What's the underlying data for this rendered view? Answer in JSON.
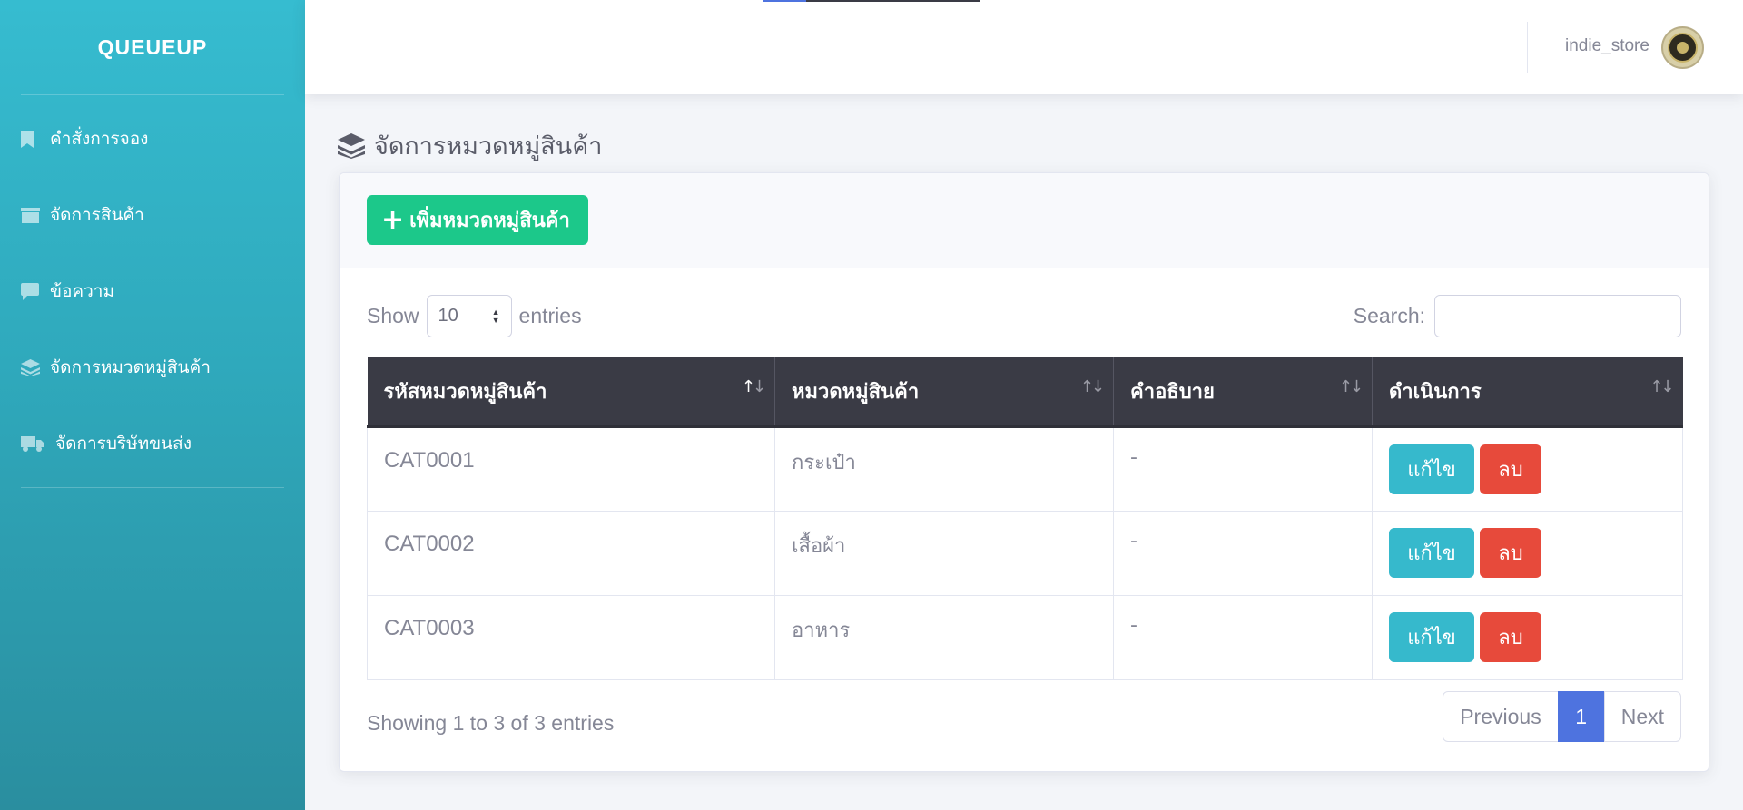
{
  "brand": "QUEUEUP",
  "sidebar": {
    "items": [
      {
        "label": "คำสั่งการจอง",
        "icon": "bookmark-icon"
      },
      {
        "label": "จัดการสินค้า",
        "icon": "box-icon"
      },
      {
        "label": "ข้อความ",
        "icon": "comment-icon"
      },
      {
        "label": "จัดการหมวดหมู่สินค้า",
        "icon": "layers-icon"
      },
      {
        "label": "จัดการบริษัทขนส่ง",
        "icon": "truck-icon"
      }
    ]
  },
  "topbar": {
    "username": "indie_store"
  },
  "page": {
    "title": "จัดการหมวดหมู่สินค้า",
    "add_button": "เพิ่มหมวดหมู่สินค้า"
  },
  "table_controls": {
    "show_label": "Show",
    "entries_label": "entries",
    "page_length": "10",
    "search_label": "Search:",
    "search_value": "",
    "search_placeholder": ""
  },
  "table": {
    "columns": [
      "รหัสหมวดหมู่สินค้า",
      "หมวดหมู่สินค้า",
      "คำอธิบาย",
      "ดำเนินการ"
    ],
    "rows": [
      {
        "code": "CAT0001",
        "name": "กระเป๋า",
        "description": "-"
      },
      {
        "code": "CAT0002",
        "name": "เสื้อผ้า",
        "description": "-"
      },
      {
        "code": "CAT0003",
        "name": "อาหาร",
        "description": "-"
      }
    ],
    "edit_label": "แก้ไข",
    "delete_label": "ลบ"
  },
  "footer": {
    "info": "Showing 1 to 3 of 3 entries",
    "previous": "Previous",
    "current_page": "1",
    "next": "Next"
  },
  "colors": {
    "sidebar_top": "#36bcd0",
    "sidebar_bottom": "#2a8e9f",
    "add_button": "#1cc88a",
    "edit_button": "#36b9cc",
    "delete_button": "#e74a3b",
    "table_header": "#3a3b45",
    "active_page": "#4e73df"
  }
}
